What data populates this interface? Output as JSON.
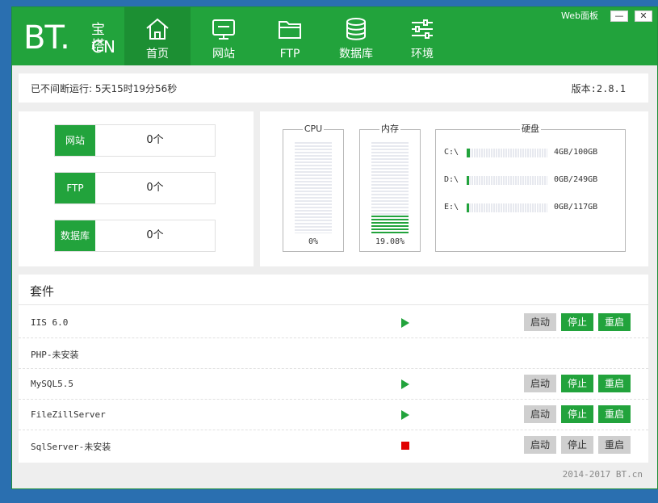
{
  "logo": {
    "bt": "BT.",
    "cn_top": "宝塔",
    "cn_bottom": "CN"
  },
  "nav": [
    {
      "label": "首页",
      "icon": "home-icon",
      "active": true
    },
    {
      "label": "网站",
      "icon": "monitor-icon",
      "active": false
    },
    {
      "label": "FTP",
      "icon": "folder-icon",
      "active": false
    },
    {
      "label": "数据库",
      "icon": "database-icon",
      "active": false
    },
    {
      "label": "环境",
      "icon": "sliders-icon",
      "active": false
    }
  ],
  "window": {
    "web_panel": "Web面板",
    "minimize": "—",
    "close": "✕"
  },
  "uptime": "已不间断运行: 5天15时19分56秒",
  "version": "版本:2.8.1",
  "stats": [
    {
      "label": "网站",
      "value": "0个"
    },
    {
      "label": "FTP",
      "value": "0个"
    },
    {
      "label": "数据库",
      "value": "0个"
    }
  ],
  "monitor": {
    "cpu": {
      "title": "CPU",
      "value": "0%",
      "percent": 0
    },
    "memory": {
      "title": "内存",
      "value": "19.08%",
      "percent": 19.08
    },
    "disk_title": "硬盘",
    "disks": [
      {
        "drive": "C:\\",
        "size": "4GB/100GB",
        "percent": 4
      },
      {
        "drive": "D:\\",
        "size": "0GB/249GB",
        "percent": 0
      },
      {
        "drive": "E:\\",
        "size": "0GB/117GB",
        "percent": 0
      }
    ]
  },
  "suite": {
    "title": "套件",
    "buttons": {
      "start": "启动",
      "stop": "停止",
      "restart": "重启"
    },
    "rows": [
      {
        "name": "IIS 6.0",
        "status": "running",
        "has_buttons": true
      },
      {
        "name": "PHP-未安装",
        "status": "none",
        "has_buttons": false
      },
      {
        "name": "MySQL5.5",
        "status": "running",
        "has_buttons": true
      },
      {
        "name": "FileZillServer",
        "status": "running",
        "has_buttons": true
      },
      {
        "name": "SqlServer-未安装",
        "status": "stopped",
        "has_buttons": true
      }
    ]
  },
  "footer": "2014-2017 BT.cn",
  "colors": {
    "brand_green": "#22a33c",
    "active_tab": "#1c8f33",
    "stopped_red": "#e00000",
    "window_bg": "#2a6fb0"
  }
}
